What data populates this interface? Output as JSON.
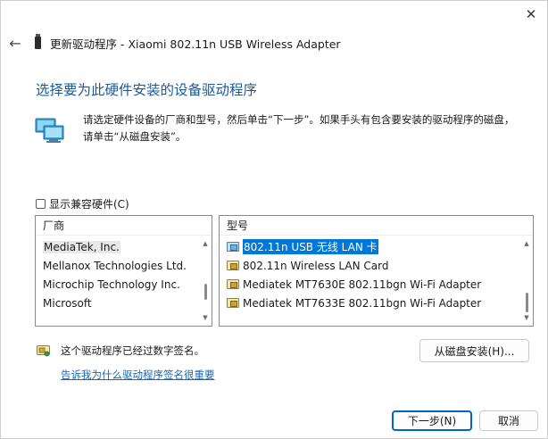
{
  "window": {
    "title": "更新驱动程序 - Xiaomi 802.11n USB Wireless Adapter",
    "close_glyph": "✕",
    "back_glyph": "←"
  },
  "heading": "选择要为此硬件安装的设备驱动程序",
  "instructions": {
    "line1": "请选定硬件设备的厂商和型号，然后单击“下一步”。如果手头有包含要安装的驱动程序的磁盘，",
    "line2": "请单击“从磁盘安装”。"
  },
  "compat_checkbox": {
    "label": "显示兼容硬件(C)",
    "checked": false
  },
  "manufacturers": {
    "header": "厂商",
    "items": [
      "MediaTek, Inc.",
      "Mellanox Technologies Ltd.",
      "Microchip Technology Inc.",
      "Microsoft"
    ],
    "selected_index": 0
  },
  "models": {
    "header": "型号",
    "items": [
      {
        "label": "802.11n USB 无线 LAN 卡",
        "icon": "network-adapter-icon"
      },
      {
        "label": "802.11n Wireless LAN Card",
        "icon": "driver-package-icon"
      },
      {
        "label": "Mediatek MT7630E 802.11bgn Wi-Fi Adapter",
        "icon": "driver-package-icon"
      },
      {
        "label": "Mediatek MT7633E 802.11bgn Wi-Fi Adapter",
        "icon": "driver-package-icon"
      }
    ],
    "selected_index": 0
  },
  "signed_text": "这个驱动程序已经过数字签名。",
  "signing_link": "告诉我为什么驱动程序签名很重要",
  "buttons": {
    "have_disk": "从磁盘安装(H)...",
    "next": "下一步(N)",
    "cancel": "取消"
  },
  "colors": {
    "heading": "#1c5a9a",
    "selection": "#0078d7",
    "link": "#1a66b5",
    "default_button_border": "#0067c0"
  }
}
